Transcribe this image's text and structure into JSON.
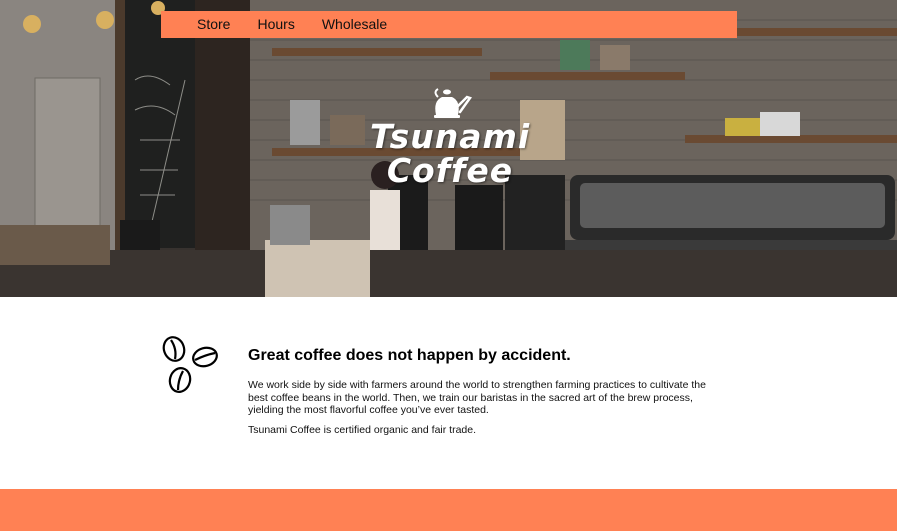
{
  "nav": {
    "items": [
      {
        "label": "Store"
      },
      {
        "label": "Hours"
      },
      {
        "label": "Wholesale"
      }
    ],
    "background_color": "#ff8154"
  },
  "hero": {
    "logo_line1": "Tsunami",
    "logo_line2": "Coffee",
    "logo_icon": "kettle-icon"
  },
  "about": {
    "icon": "coffee-beans-icon",
    "headline": "Great coffee does not happen by accident.",
    "paragraph1": "We work side by side with farmers around the world to strengthen farming practices to cultivate the best coffee beans in the world. Then, we train our baristas in the sacred art of the brew process, yielding the most flavorful coffee you’ve ever tasted.",
    "paragraph2": "Tsunami Coffee is certified organic and fair trade."
  },
  "footer": {
    "background_color": "#ff8154"
  }
}
